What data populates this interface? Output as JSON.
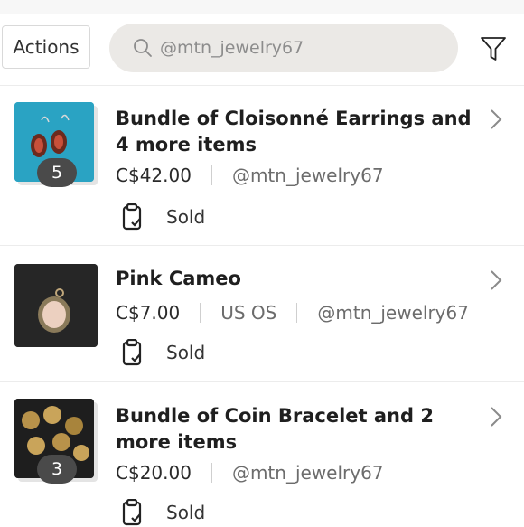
{
  "toolbar": {
    "actions_label": "Actions",
    "search_value": "@mtn_jewelry67",
    "search_icon": "search-icon",
    "filter_icon": "filter-icon"
  },
  "listings": [
    {
      "title": "Bundle of Cloisonné Earrings and 4 more items",
      "price": "C$42.00",
      "size": "",
      "seller": "@mtn_jewelry67",
      "status": "Sold",
      "bundle_count": "5",
      "thumb_colors": [
        "#2aa3c3",
        "#b24a3a"
      ]
    },
    {
      "title": "Pink Cameo",
      "price": "C$7.00",
      "size": "US OS",
      "seller": "@mtn_jewelry67",
      "status": "Sold",
      "bundle_count": "",
      "thumb_colors": [
        "#262626",
        "#e8c8b8"
      ]
    },
    {
      "title": "Bundle of Coin Bracelet and 2 more items",
      "price": "C$20.00",
      "size": "",
      "seller": "@mtn_jewelry67",
      "status": "Sold",
      "bundle_count": "3",
      "thumb_colors": [
        "#1e1e1e",
        "#c9a45a"
      ]
    }
  ],
  "colors": {
    "search_bg": "#ebe9e6",
    "badge_bg": "#4a4a4a",
    "divider": "#ececec"
  }
}
